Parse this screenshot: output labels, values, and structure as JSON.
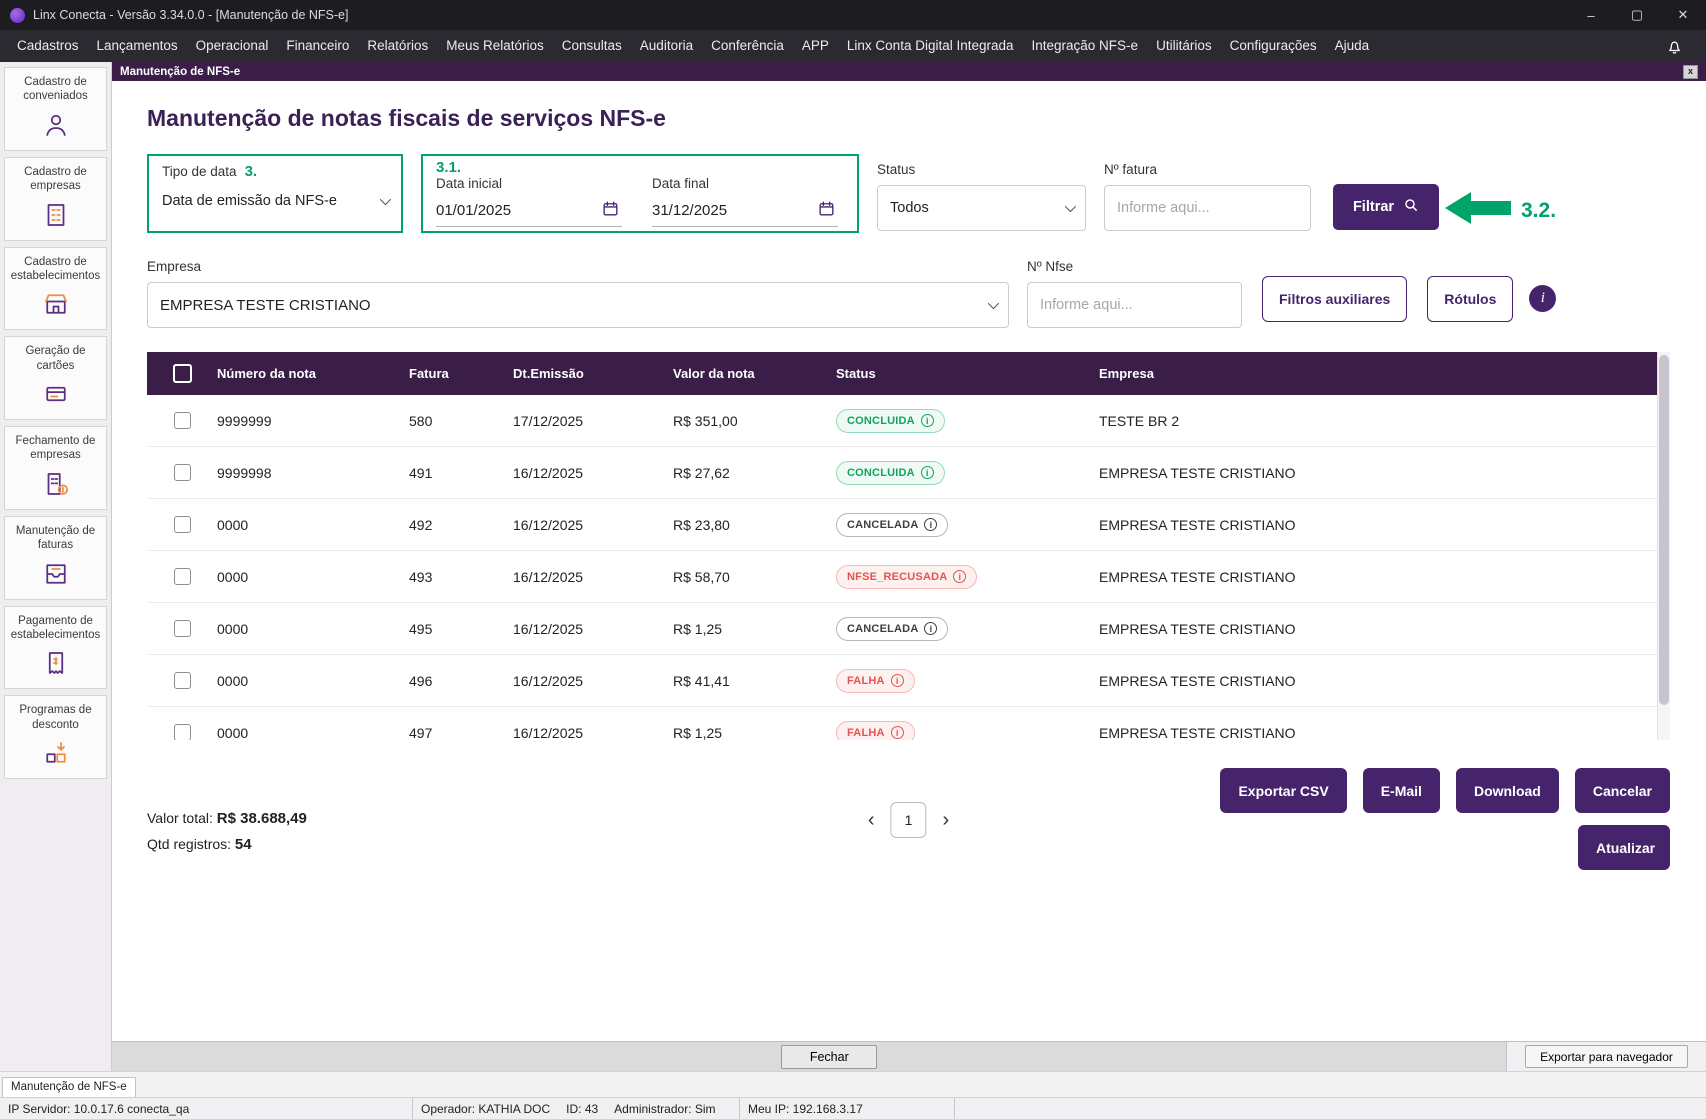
{
  "window": {
    "title": "Linx Conecta - Versão 3.34.0.0 - [Manutenção de NFS-e]"
  },
  "window_controls": {
    "minimize": "–",
    "maximize": "▢",
    "close": "✕"
  },
  "menu": {
    "items": [
      "Cadastros",
      "Lançamentos",
      "Operacional",
      "Financeiro",
      "Relatórios",
      "Meus Relatórios",
      "Consultas",
      "Auditoria",
      "Conferência",
      "APP",
      "Linx Conta Digital Integrada",
      "Integração NFS-e",
      "Utilitários",
      "Configurações",
      "Ajuda"
    ]
  },
  "sidebar": {
    "items": [
      {
        "label": "Cadastro de conveniados",
        "icon": "person-icon"
      },
      {
        "label": "Cadastro de empresas",
        "icon": "building-icon"
      },
      {
        "label": "Cadastro de estabelecimentos",
        "icon": "store-icon"
      },
      {
        "label": "Geração de cartões",
        "icon": "cards-icon"
      },
      {
        "label": "Fechamento de empresas",
        "icon": "closing-dollar-icon"
      },
      {
        "label": "Manutenção de faturas",
        "icon": "invoice-tray-icon"
      },
      {
        "label": "Pagamento de estabelecimentos",
        "icon": "payment-receipt-icon"
      },
      {
        "label": "Programas de desconto",
        "icon": "discount-boxes-icon"
      }
    ]
  },
  "tab_strip": {
    "title": "Manutenção de NFS-e",
    "close": "x"
  },
  "page": {
    "title": "Manutenção de notas fiscais de serviços NFS-e"
  },
  "filters": {
    "tipo_de_data": {
      "label": "Tipo de data",
      "annotation": "3.",
      "value": "Data de emissão da NFS-e"
    },
    "date_annotation": "3.1.",
    "data_inicial": {
      "label": "Data inicial",
      "value": "01/01/2025"
    },
    "data_final": {
      "label": "Data final",
      "value": "31/12/2025"
    },
    "status": {
      "label": "Status",
      "value": "Todos"
    },
    "n_fatura": {
      "label": "Nº fatura",
      "placeholder": "Informe aqui..."
    },
    "filtrar_label": "Filtrar",
    "filtrar_annotation": "3.2.",
    "empresa": {
      "label": "Empresa",
      "value": "EMPRESA TESTE CRISTIANO"
    },
    "n_nfse": {
      "label": "Nº Nfse",
      "placeholder": "Informe aqui..."
    },
    "filtros_auxiliares_label": "Filtros auxiliares",
    "rotulos_label": "Rótulos",
    "info_glyph": "i"
  },
  "table": {
    "columns": [
      "Número da nota",
      "Fatura",
      "Dt.Emissão",
      "Valor da nota",
      "Status",
      "Empresa"
    ],
    "rows": [
      {
        "numero": "9999999",
        "fatura": "580",
        "dt_emissao": "17/12/2025",
        "valor": "R$ 351,00",
        "status": "CONCLUIDA",
        "status_type": "success",
        "empresa": "TESTE BR 2"
      },
      {
        "numero": "9999998",
        "fatura": "491",
        "dt_emissao": "16/12/2025",
        "valor": "R$ 27,62",
        "status": "CONCLUIDA",
        "status_type": "success",
        "empresa": "EMPRESA TESTE CRISTIANO"
      },
      {
        "numero": "0000",
        "fatura": "492",
        "dt_emissao": "16/12/2025",
        "valor": "R$ 23,80",
        "status": "CANCELADA",
        "status_type": "neutral",
        "empresa": "EMPRESA TESTE CRISTIANO"
      },
      {
        "numero": "0000",
        "fatura": "493",
        "dt_emissao": "16/12/2025",
        "valor": "R$ 58,70",
        "status": "NFSE_RECUSADA",
        "status_type": "danger",
        "empresa": "EMPRESA TESTE CRISTIANO"
      },
      {
        "numero": "0000",
        "fatura": "495",
        "dt_emissao": "16/12/2025",
        "valor": "R$ 1,25",
        "status": "CANCELADA",
        "status_type": "neutral",
        "empresa": "EMPRESA TESTE CRISTIANO"
      },
      {
        "numero": "0000",
        "fatura": "496",
        "dt_emissao": "16/12/2025",
        "valor": "R$ 41,41",
        "status": "FALHA",
        "status_type": "danger",
        "empresa": "EMPRESA TESTE CRISTIANO"
      },
      {
        "numero": "0000",
        "fatura": "497",
        "dt_emissao": "16/12/2025",
        "valor": "R$ 1,25",
        "status": "FALHA",
        "status_type": "danger",
        "empresa": "EMPRESA TESTE CRISTIANO"
      }
    ]
  },
  "summary": {
    "valor_total_label": "Valor total:",
    "valor_total": "R$ 38.688,49",
    "qtd_label": "Qtd registros:",
    "qtd": "54"
  },
  "pagination": {
    "prev": "‹",
    "page": "1",
    "next": "›"
  },
  "actions": {
    "exportar_csv": "Exportar CSV",
    "email": "E-Mail",
    "download": "Download",
    "cancelar": "Cancelar",
    "atualizar": "Atualizar"
  },
  "footer": {
    "fechar": "Fechar",
    "exportar_navegador": "Exportar para navegador",
    "bottom_tab": "Manutenção de NFS-e"
  },
  "statusbar": {
    "ip_servidor": "IP Servidor: 10.0.17.6 conecta_qa",
    "operador": "Operador: KATHIA DOC",
    "id": "ID: 43",
    "administrador": "Administrador: Sim",
    "meu_ip": "Meu IP: 192.168.3.17"
  },
  "colors": {
    "accent_purple": "#46246B",
    "header_purple": "#3A1E47",
    "annotation_green": "#00A368",
    "status_success": "#12A35F",
    "status_danger": "#E5524F",
    "status_neutral": "#3F3F3F"
  }
}
